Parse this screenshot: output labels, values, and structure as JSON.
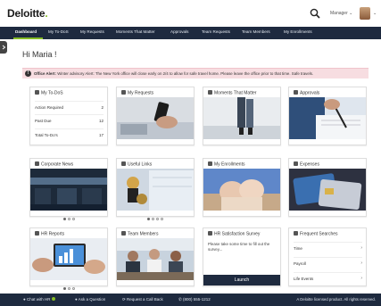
{
  "brand": {
    "name": "Deloitte",
    "dot": ".",
    "accent": "#86bc25",
    "nav_bg": "#1e2a3f"
  },
  "header": {
    "user_label": "Manager ⌄",
    "avatar_caret": "⌄"
  },
  "nav": {
    "items": [
      {
        "label": "Dashboard",
        "active": true
      },
      {
        "label": "My To-DoS"
      },
      {
        "label": "My Requests"
      },
      {
        "label": "Moments That Matter"
      },
      {
        "label": "Approvals"
      },
      {
        "label": "Team Requests"
      },
      {
        "label": "Team Members"
      },
      {
        "label": "My Enrollments"
      }
    ]
  },
  "greeting": "Hi Maria !",
  "alert": {
    "label": "Office Alert:",
    "text": "Winter advisory Alert: The New York office will close early on 2/4 to allow for safe travel home. Please leave the office prior to that time. Safe travels."
  },
  "cards": {
    "todos": {
      "title": "My To-DoS",
      "rows": [
        {
          "label": "Action Required",
          "count": "2"
        },
        {
          "label": "Past Due",
          "count": "12"
        },
        {
          "label": "Total To-Do's",
          "count": "17"
        }
      ]
    },
    "requests": {
      "title": "My Requests"
    },
    "moments": {
      "title": "Moments That Matter"
    },
    "approvals": {
      "title": "Approvals"
    },
    "news": {
      "title": "Corporate News"
    },
    "links": {
      "title": "Useful Links"
    },
    "enrollments": {
      "title": "My Enrollments"
    },
    "expenses": {
      "title": "Expenses"
    },
    "hr_reports": {
      "title": "HR Reports"
    },
    "team_members": {
      "title": "Team Members"
    },
    "survey": {
      "title": "HR Satisfaction Survey",
      "text": "Please take some time to fill out the survey...",
      "button": "Launch"
    },
    "frequent": {
      "title": "Frequent Searches",
      "rows": [
        "Time",
        "Payroll",
        "Life Events"
      ]
    }
  },
  "footer": {
    "chat": "Chat with HR",
    "ask": "Ask a Question",
    "callback": "Request a Call Back",
    "phone": "(800) 555-1212",
    "legal": "A Deloitte licensed product. All rights reserved."
  }
}
